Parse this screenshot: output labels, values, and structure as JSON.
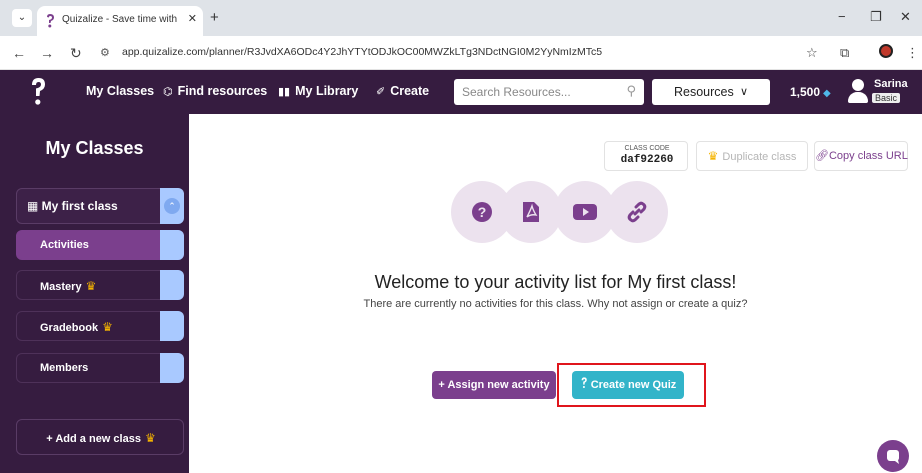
{
  "browser": {
    "tab_title": "Quizalize - Save time with pers",
    "url": "app.quizalize.com/planner/R3JvdXA6ODc4Y2JhYTYtODJkOC00MWZkLTg3NDctNGI0M2YyNmIzMTc5",
    "new_tab": "+",
    "tab_close": "✕",
    "window_minimize": "−",
    "window_restore": "❐",
    "window_close": "✕"
  },
  "header": {
    "nav": [
      {
        "label": "My Classes"
      },
      {
        "label": "Find resources"
      },
      {
        "label": "My Library"
      },
      {
        "label": "Create"
      }
    ],
    "search_placeholder": "Search Resources...",
    "resources_label": "Resources",
    "credits": "1,500",
    "user_name": "Sarina",
    "user_plan": "Basic"
  },
  "sidebar": {
    "title": "My Classes",
    "class_name": "My first class",
    "items": [
      {
        "label": "Activities",
        "premium": false
      },
      {
        "label": "Mastery",
        "premium": true
      },
      {
        "label": "Gradebook",
        "premium": true
      },
      {
        "label": "Members",
        "premium": false
      }
    ],
    "add_class": "Add a new class"
  },
  "main": {
    "class_code_label": "CLASS CODE",
    "class_code": "daf92260",
    "duplicate_label": "Duplicate class",
    "copy_url_label": "Copy class URL",
    "welcome": "Welcome to your activity list for My first class!",
    "subtext": "There are currently no activities for this class. Why not assign or create a quiz?",
    "assign_label": "Assign new activity",
    "create_label": "Create new Quiz"
  },
  "colors": {
    "header_bg": "#361c40",
    "accent_purple": "#7b3f8d",
    "create_teal": "#32b4c9",
    "highlight_red": "#e0151c",
    "crown_gold": "#f5b400"
  },
  "icons": [
    "question-icon",
    "pdf-icon",
    "video-icon",
    "link-icon",
    "crown-icon",
    "grid-icon",
    "binoculars-icon",
    "book-icon",
    "magic-wand-icon",
    "gem-icon"
  ]
}
